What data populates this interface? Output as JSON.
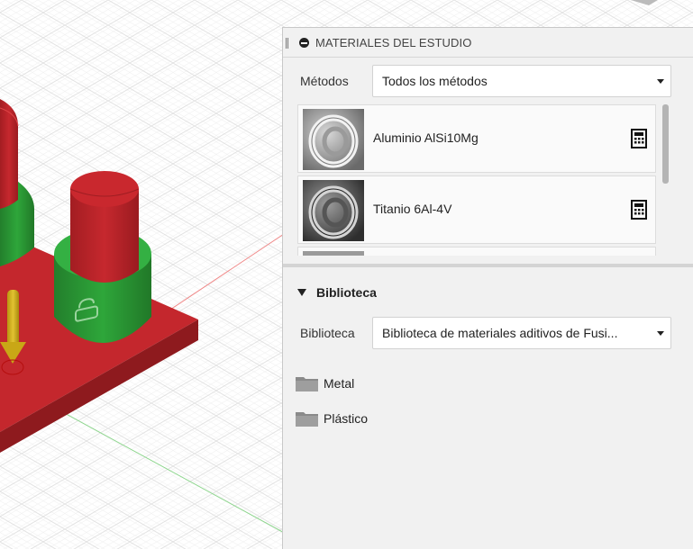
{
  "panel": {
    "title": "MATERIALES DEL ESTUDIO",
    "methods_label": "Métodos",
    "methods_value": "Todos los métodos",
    "materials": [
      {
        "name": "Aluminio AlSi10Mg",
        "icon": "calculator-icon"
      },
      {
        "name": "Titanio 6Al-4V",
        "icon": "calculator-icon"
      }
    ],
    "library_section": "Biblioteca",
    "library_label": "Biblioteca",
    "library_value": "Biblioteca de materiales aditivos de Fusi...",
    "folders": [
      {
        "name": "Metal",
        "icon": "folder-icon"
      },
      {
        "name": "Plástico",
        "icon": "folder-icon"
      }
    ]
  },
  "colors": {
    "part_red": "#c0272d",
    "part_green": "#2c9a37",
    "arrow_yellow": "#d4b21a",
    "panel_bg": "#f1f1f1"
  }
}
